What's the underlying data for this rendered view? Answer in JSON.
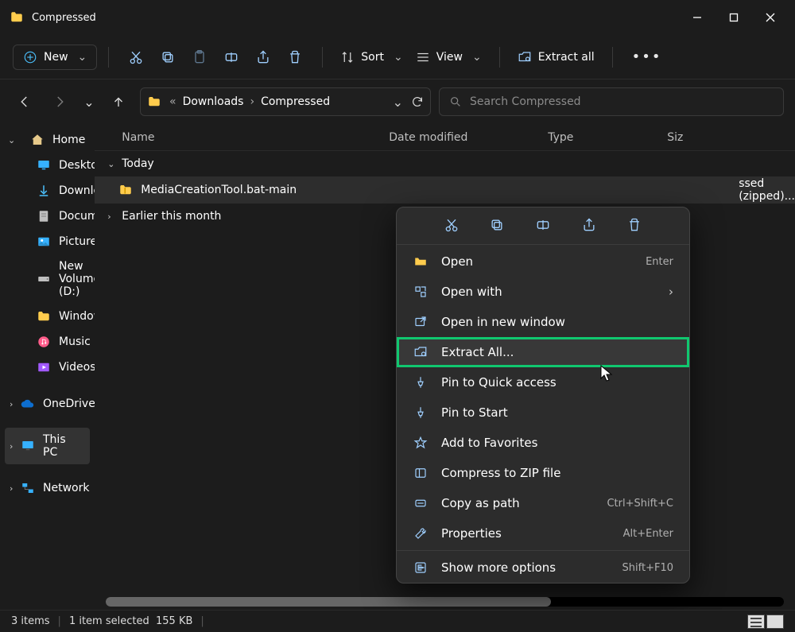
{
  "window": {
    "title": "Compressed"
  },
  "toolbar": {
    "new": "New",
    "sort": "Sort",
    "view": "View",
    "extract_all": "Extract all"
  },
  "breadcrumbs": {
    "seg1": "Downloads",
    "seg2": "Compressed"
  },
  "search": {
    "placeholder": "Search Compressed"
  },
  "sidebar": {
    "home": "Home",
    "desktop": "Desktop",
    "downloads": "Downloads",
    "documents": "Documents",
    "pictures": "Pictures",
    "newvol": "New Volume (D:)",
    "windows": "Windows",
    "music": "Music",
    "videos": "Videos",
    "onedrive": "OneDrive - Personal",
    "thispc": "This PC",
    "network": "Network"
  },
  "columns": {
    "name": "Name",
    "date": "Date modified",
    "type": "Type",
    "size": "Siz"
  },
  "groups": {
    "today": "Today",
    "earlier": "Earlier this month"
  },
  "files": {
    "row0": {
      "name": "MediaCreationTool.bat-main",
      "type": "ssed (zipped)..."
    }
  },
  "context": {
    "open": "Open",
    "open_hint": "Enter",
    "openwith": "Open with",
    "newwindow": "Open in new window",
    "extractall": "Extract All...",
    "pinqa": "Pin to Quick access",
    "pinstart": "Pin to Start",
    "addfav": "Add to Favorites",
    "compress": "Compress to ZIP file",
    "copypath": "Copy as path",
    "copypath_hint": "Ctrl+Shift+C",
    "properties": "Properties",
    "properties_hint": "Alt+Enter",
    "showmore": "Show more options",
    "showmore_hint": "Shift+F10"
  },
  "status": {
    "items": "3 items",
    "selected": "1 item selected",
    "size": "155 KB"
  }
}
